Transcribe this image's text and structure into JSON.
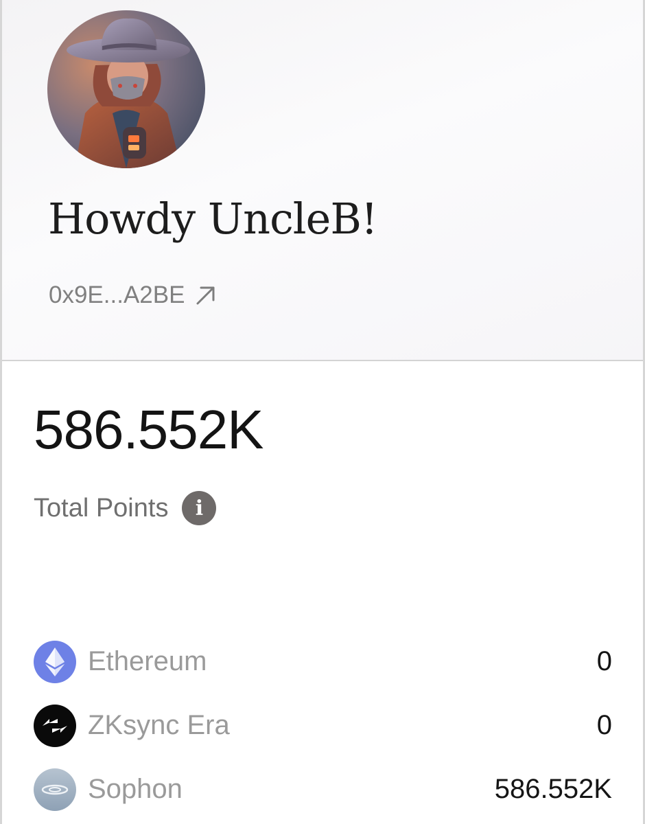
{
  "profile": {
    "greeting": "Howdy UncleB!",
    "address": "0x9E...A2BE",
    "avatar_icon": "cowboy-masked-avatar",
    "link_icon": "arrow-up-right-icon"
  },
  "points": {
    "total_value": "586.552K",
    "total_label": "Total Points",
    "info_icon": "info-icon",
    "info_glyph": "i"
  },
  "chains": [
    {
      "name": "Ethereum",
      "value": "0",
      "icon": "ethereum-icon",
      "color": "#6e81e6"
    },
    {
      "name": "ZKsync Era",
      "value": "0",
      "icon": "zksync-icon",
      "color": "#0a0a0a"
    },
    {
      "name": "Sophon",
      "value": "586.552K",
      "icon": "sophon-icon",
      "color": "#9fb0c2"
    }
  ]
}
